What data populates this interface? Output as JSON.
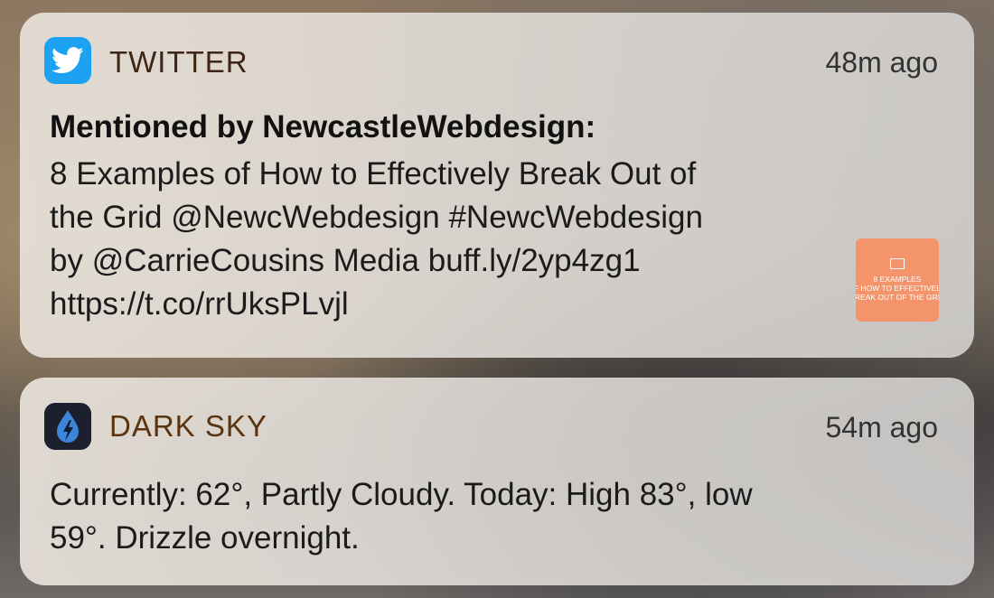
{
  "notifications": [
    {
      "app": "TWITTER",
      "icon": "twitter-bird-icon",
      "time": "48m ago",
      "title": "Mentioned by NewcastleWebdesign:",
      "lines": [
        "8 Examples of How to Effectively Break Out of",
        "the Grid @NewcWebdesign #NewcWebdesign",
        "by @CarrieCousins Media buff.ly/2yp4zg1",
        "https://t.co/rrUksPLvjl"
      ],
      "thumbnail_lines": [
        "8 EXAMPLES",
        "F HOW TO EFFECTIVEL",
        "REAK OUT OF THE GRI"
      ],
      "thumbnail_color": "#f3946a",
      "icon_color": "#1da1f2"
    },
    {
      "app": "DARK SKY",
      "icon": "raindrop-lightning-icon",
      "time": "54m ago",
      "lines": [
        "Currently: 62°, Partly Cloudy. Today:  High 83°, low",
        "59°. Drizzle overnight."
      ],
      "icon_color": "#1b1f2e"
    }
  ]
}
